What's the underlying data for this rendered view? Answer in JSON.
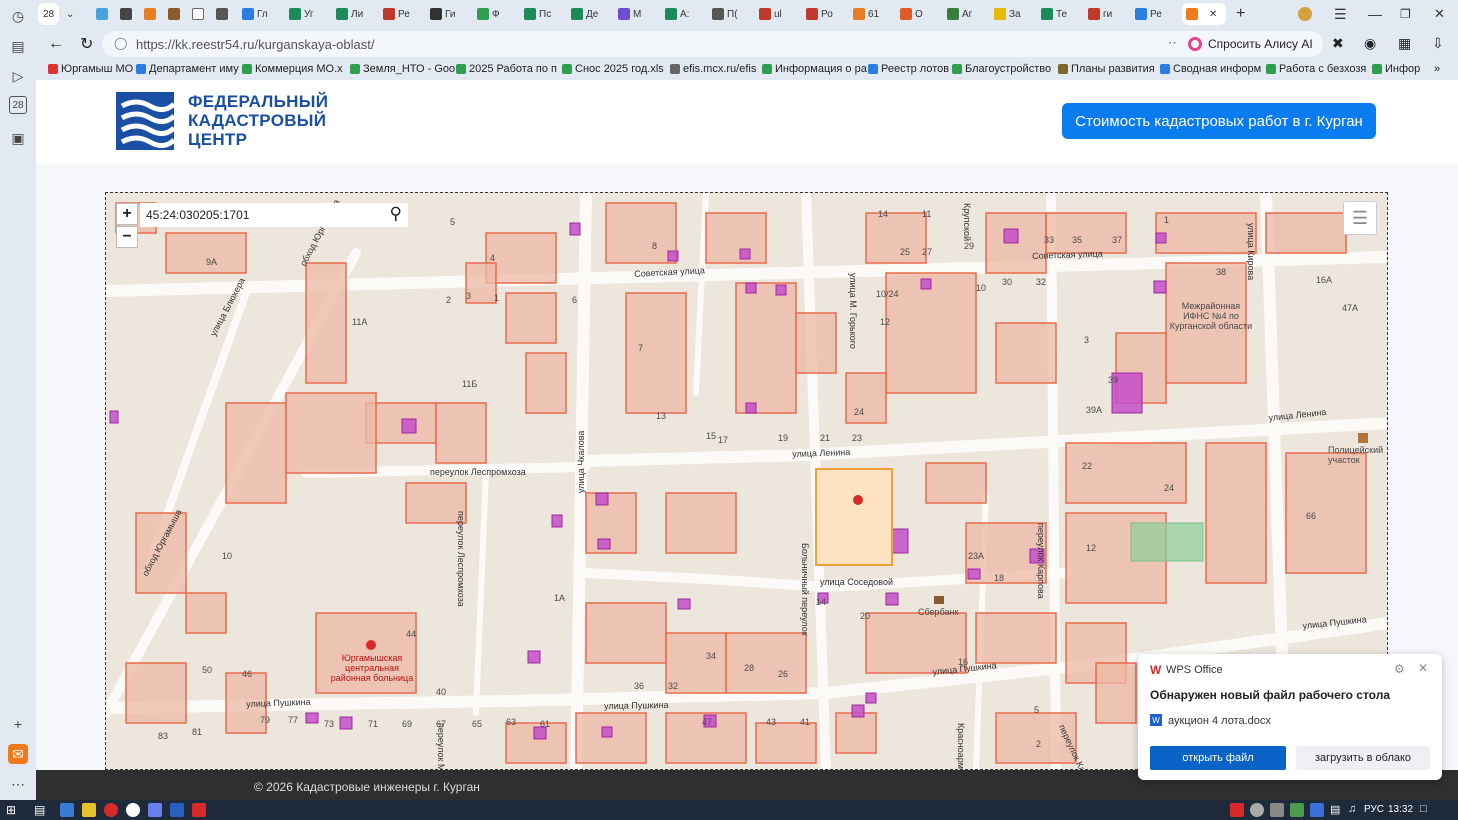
{
  "browser": {
    "tab_count": "28",
    "tabs": [
      {
        "label": "Гл",
        "color": "#2a7de1"
      },
      {
        "label": "Уг",
        "color": "#1c8a5a"
      },
      {
        "label": "Ли",
        "color": "#1c8a5a"
      },
      {
        "label": "Ре",
        "color": "#c0392b"
      },
      {
        "label": "Ги",
        "color": "#333333"
      },
      {
        "label": "Ф",
        "color": "#2e9e4f"
      },
      {
        "label": "Пс",
        "color": "#1c8a5a"
      },
      {
        "label": "Де",
        "color": "#1c8a5a"
      },
      {
        "label": "М",
        "color": "#6c4dd6"
      },
      {
        "label": "А:",
        "color": "#1c8a5a"
      },
      {
        "label": "П(",
        "color": "#555555"
      },
      {
        "label": "ul",
        "color": "#c0392b"
      },
      {
        "label": "Ро",
        "color": "#c0392b"
      },
      {
        "label": "61",
        "color": "#e67e22"
      },
      {
        "label": "О",
        "color": "#e05a2a"
      },
      {
        "label": "Аг",
        "color": "#3a7d3a"
      },
      {
        "label": "За",
        "color": "#e6b800"
      },
      {
        "label": "Те",
        "color": "#1c8a5a"
      },
      {
        "label": "ги",
        "color": "#c0392b"
      },
      {
        "label": "Ре",
        "color": "#2a7de1"
      }
    ],
    "url": "https://kk.reestr54.ru/kurganskaya-oblast/",
    "alice_label": "Спросить Алису AI"
  },
  "bookmarks": [
    "Юргамыш МО",
    "Департамент иму",
    "Коммерция МО.x",
    "Земля_НТО - Goo",
    "2025 Работа по п",
    "Снос 2025 год.xls",
    "efis.mcx.ru/efis",
    "Информация о ра",
    "Реестр лотов",
    "Благоустройство",
    "Планы развития",
    "Сводная информ",
    "Работа с безхозя",
    "Инфор"
  ],
  "site": {
    "logo_lines": [
      "ФЕДЕРАЛЬНЫЙ",
      "КАДАСТРОВЫЙ",
      "ЦЕНТР"
    ],
    "cta_label": "Стоимость кадастровых работ в г. Курган",
    "footer_text": "© 2026 Кадастровые инженеры г. Курган",
    "brand_color": "#1a4fa3",
    "cta_color": "#0a7cf0"
  },
  "map": {
    "search_value": "45:24:030205:1701",
    "zoom_in": "+",
    "zoom_out": "−",
    "streets": [
      "Советская улица",
      "Советская улица",
      "улица Ленина",
      "улица Ленина",
      "переулок Леспромхоза",
      "улица Чкалова",
      "улица Соседовой",
      "улица Пушкина",
      "улица Пушкина",
      "улица Пушкина",
      "улица Пушкина",
      "улица Кирова",
      "переулок Карпова",
      "Больничный переулок",
      "улица М. Горького",
      "улица Блюхера",
      "обход Юргамыша",
      "обход Юргамыша",
      "переулок Леспромхоза",
      "Крупской",
      "Красноармейская",
      "переулок Карпова",
      "переулок Ма"
    ],
    "pois": [
      "Межрайонная ИФНС №4 по Курганской области",
      "Полицейский участок",
      "Юргамышская центральная районная больница",
      "Сбербанк"
    ],
    "house_numbers": [
      "9А",
      "11А",
      "11Б",
      "44",
      "50",
      "46",
      "10",
      "5",
      "4",
      "3",
      "2",
      "1",
      "6",
      "8",
      "7",
      "13",
      "15",
      "17",
      "19",
      "21",
      "23",
      "24",
      "25",
      "27",
      "29",
      "30",
      "32",
      "33",
      "35",
      "37",
      "38",
      "39",
      "39А",
      "3",
      "66",
      "22",
      "24",
      "12",
      "14",
      "20",
      "16",
      "18",
      "23А",
      "36",
      "32",
      "34",
      "28",
      "26",
      "47А",
      "16А",
      "10/24",
      "12",
      "11",
      "14",
      "1А",
      "40",
      "79",
      "77",
      "73",
      "71",
      "69",
      "67",
      "65",
      "63",
      "61",
      "83",
      "81",
      "47",
      "43",
      "41",
      "5",
      "2",
      "1",
      "10"
    ],
    "parcel_color": "#e96b4e",
    "highlight_color": "#c44ec9"
  },
  "toast": {
    "app": "WPS Office",
    "title": "Обнаружен новый файл рабочего стола",
    "file": "аукцион 4 лота.docx",
    "open_label": "открыть файл",
    "upload_label": "загрузить в облако"
  },
  "taskbar": {
    "lang": "РУС",
    "time": "13:32"
  }
}
